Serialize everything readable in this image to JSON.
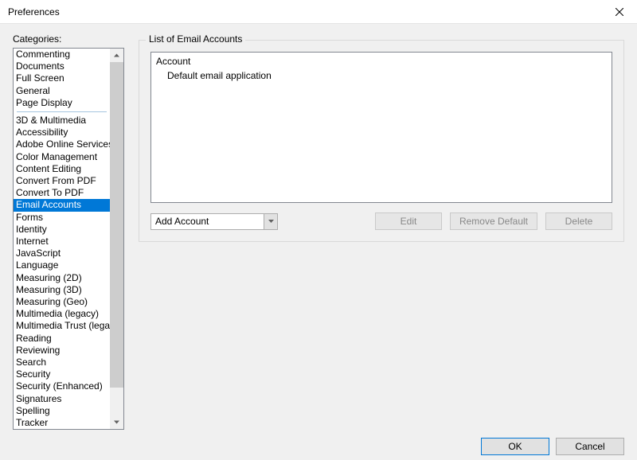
{
  "window": {
    "title": "Preferences"
  },
  "sidebar": {
    "label": "Categories:",
    "primary": [
      "Commenting",
      "Documents",
      "Full Screen",
      "General",
      "Page Display"
    ],
    "secondary": [
      "3D & Multimedia",
      "Accessibility",
      "Adobe Online Services",
      "Color Management",
      "Content Editing",
      "Convert From PDF",
      "Convert To PDF",
      "Email Accounts",
      "Forms",
      "Identity",
      "Internet",
      "JavaScript",
      "Language",
      "Measuring (2D)",
      "Measuring (3D)",
      "Measuring (Geo)",
      "Multimedia (legacy)",
      "Multimedia Trust (legacy)",
      "Reading",
      "Reviewing",
      "Search",
      "Security",
      "Security (Enhanced)",
      "Signatures",
      "Spelling",
      "Tracker"
    ],
    "selected": "Email Accounts"
  },
  "main": {
    "group_label": "List of Email Accounts",
    "accounts": {
      "column_header": "Account",
      "rows": [
        "Default email application"
      ]
    },
    "add_account_label": "Add Account",
    "edit_label": "Edit",
    "remove_default_label": "Remove Default",
    "delete_label": "Delete"
  },
  "footer": {
    "ok_label": "OK",
    "cancel_label": "Cancel"
  }
}
